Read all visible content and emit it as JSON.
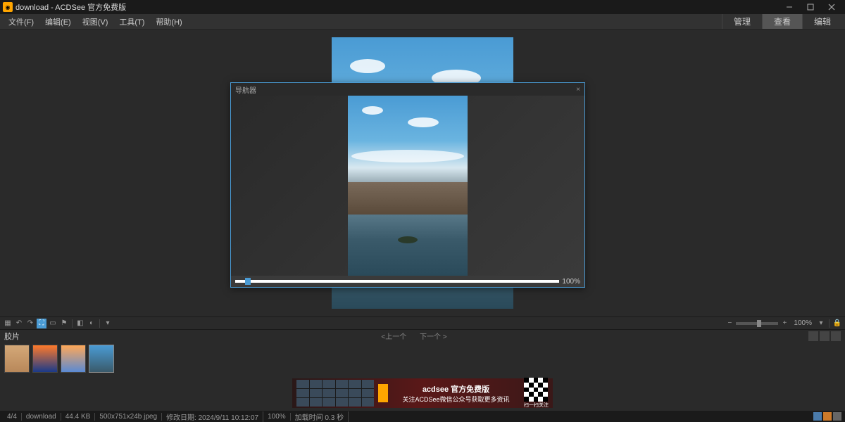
{
  "titlebar": {
    "title": "download - ACDSee 官方免费版"
  },
  "menubar": {
    "items": [
      "文件(F)",
      "编辑(E)",
      "视图(V)",
      "工具(T)",
      "帮助(H)"
    ],
    "modes": [
      "管理",
      "查看",
      "编辑"
    ],
    "active_mode": "查看"
  },
  "navigator": {
    "title": "导航器",
    "percent": "100%"
  },
  "toolbar": {
    "zoom": "100%"
  },
  "filmstrip": {
    "label": "胶片",
    "prev": "<上一个",
    "next": "下一个 >"
  },
  "ad": {
    "line1": "acdsee 官方免费版",
    "line2": "关注ACDSee微信公众号获取更多资讯",
    "qr_label": "扫一扫关注"
  },
  "statusbar": {
    "index": "4/4",
    "folder": "download",
    "filesize": "44.4 KB",
    "dimensions": "500x751x24b jpeg",
    "modified": "修改日期: 2024/9/11 10:12:07",
    "zoom": "100%",
    "loadtime": "加载时间 0.3 秒"
  },
  "thumbs": [
    {
      "bg": "linear-gradient(#d4a878, #b8885a)"
    },
    {
      "bg": "linear-gradient(#ff7a2a, #1a3a8a)"
    },
    {
      "bg": "linear-gradient(#ffa858, #5a8ad4)"
    },
    {
      "bg": "linear-gradient(#4a9bd4, #3a5a6a)"
    }
  ]
}
